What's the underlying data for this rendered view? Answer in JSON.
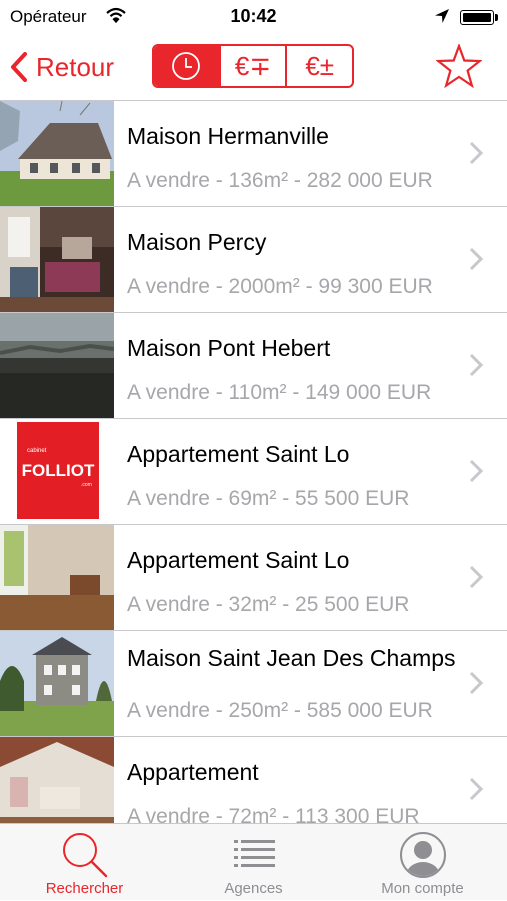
{
  "status_bar": {
    "carrier": "Opérateur",
    "time": "10:42"
  },
  "nav": {
    "back_label": "Retour",
    "segments": [
      {
        "icon": "clock-icon",
        "active": true
      },
      {
        "icon": "euro-minus-plus-icon",
        "label": "€∓",
        "active": false
      },
      {
        "icon": "euro-plus-minus-icon",
        "label": "€±",
        "active": false
      }
    ],
    "favorite_icon": "star-icon"
  },
  "accent_color": "#e8262c",
  "listings": [
    {
      "title": "Maison Hermanville",
      "subtitle": "A vendre - 136m² - 282 000 EUR"
    },
    {
      "title": "Maison Percy",
      "subtitle": "A vendre - 2000m² - 99 300 EUR"
    },
    {
      "title": "Maison Pont Hebert",
      "subtitle": "A vendre - 110m² - 149 000 EUR"
    },
    {
      "title": "Appartement Saint Lo",
      "subtitle": "A vendre - 69m² - 55 500  EUR",
      "logo_text": "FOLLIOT"
    },
    {
      "title": "Appartement Saint Lo",
      "subtitle": "A vendre - 32m² - 25 500  EUR"
    },
    {
      "title": "Maison Saint Jean Des Champs",
      "subtitle": "A vendre - 250m² - 585 000 EUR"
    },
    {
      "title": "Appartement",
      "subtitle": "A vendre - 72m² - 113 300 EUR"
    }
  ],
  "tabs": [
    {
      "label": "Rechercher",
      "icon": "search-icon",
      "active": true
    },
    {
      "label": "Agences",
      "icon": "list-icon",
      "active": false
    },
    {
      "label": "Mon compte",
      "icon": "user-icon",
      "active": false
    }
  ]
}
